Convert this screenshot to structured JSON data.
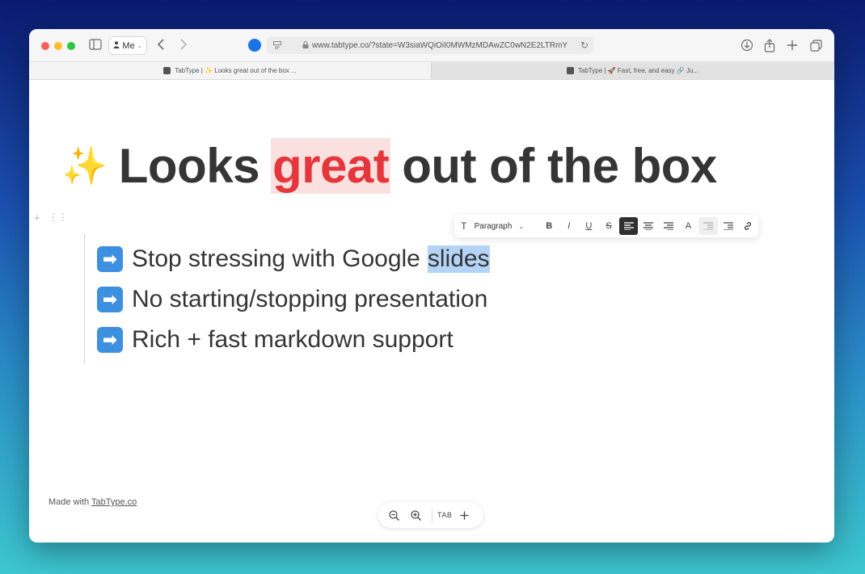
{
  "browser": {
    "profile_label": "Me",
    "url": "www.tabtype.co/?state=W3siaWQiOiI0MWMzMDAwZC0wN2E2LTRmY",
    "tabs": [
      {
        "label": "TabType | ✨ Looks great out of the box ..."
      },
      {
        "label": "TabType | 🚀 Fast, free, and easy 🔗 Ju..."
      }
    ]
  },
  "slide": {
    "title_emoji": "✨",
    "title_before": "Looks",
    "title_highlight": "great",
    "title_after": "out of the box",
    "bullet_emoji": "➡",
    "bullets": [
      {
        "text": "Stop stressing with Google",
        "selected_text": "slides"
      },
      {
        "text": "No starting/stopping presentation",
        "selected_text": ""
      },
      {
        "text": "Rich + fast markdown support",
        "selected_text": ""
      }
    ]
  },
  "format_toolbar": {
    "block_type": "Paragraph",
    "buttons": [
      "B",
      "I",
      "U",
      "S",
      "align-left",
      "align-center",
      "align-right",
      "A",
      "outdent",
      "indent",
      "link"
    ]
  },
  "footer": {
    "made_with": "Made with",
    "link_text": "TabType.co"
  },
  "zoom_controls": {
    "tab_label": "TAB"
  },
  "colors": {
    "highlight_bg": "#fbe0e0",
    "highlight_text": "#e4363b",
    "selection": "#b4d4f7",
    "arrow_blue": "#3d8fe0"
  }
}
